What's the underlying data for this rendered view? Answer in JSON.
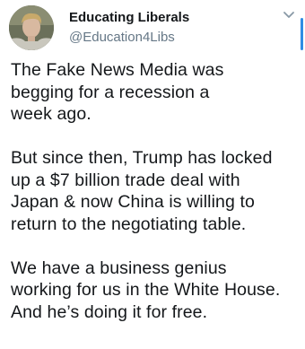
{
  "tweet": {
    "author": {
      "display_name": "Educating Liberals",
      "handle": "@Education4Libs",
      "avatar_icon": "profile-photo"
    },
    "menu_icon": "chevron-down-icon",
    "accent_color": "#2f8de4",
    "paragraphs": [
      {
        "lines": [
          "The Fake News Media was",
          "begging for a recession a",
          "week ago."
        ]
      },
      {
        "lines": [
          "But since then, Trump has locked",
          "up a $7 billion trade deal with",
          "Japan & now China is willing to",
          "return to the negotiating table."
        ]
      },
      {
        "lines": [
          "We have a business genius",
          "working for us in the White House.",
          "And he’s doing it for free."
        ]
      }
    ]
  }
}
